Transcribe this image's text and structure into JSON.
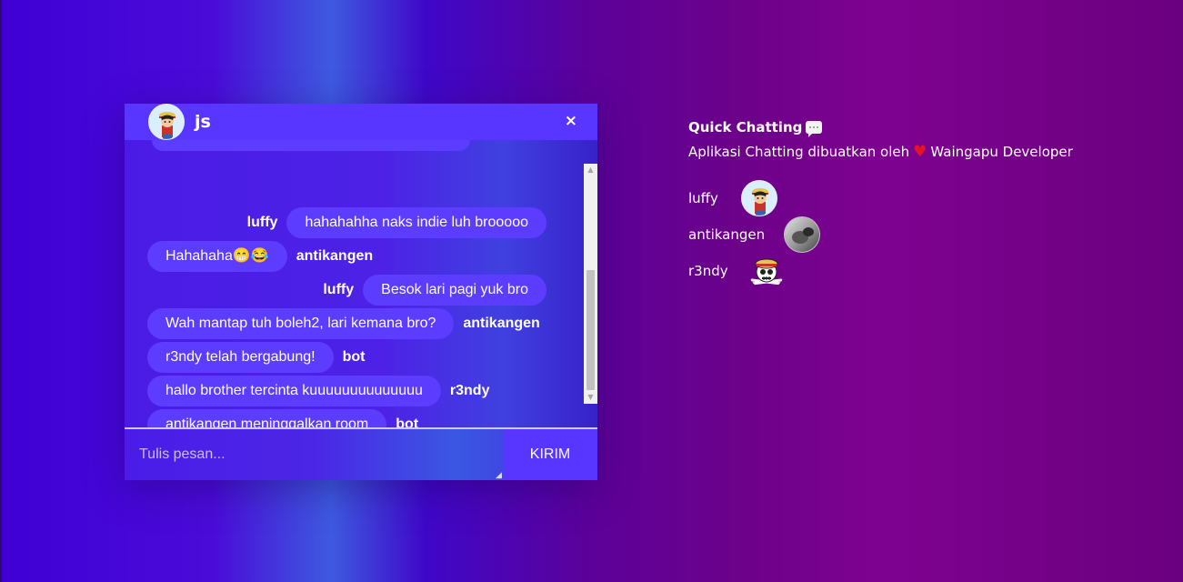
{
  "chat": {
    "title": "js",
    "close_label": "×",
    "messages": [
      {
        "sender": "luffy",
        "text": "hahahahha naks indie luh brooooo",
        "side": "right"
      },
      {
        "sender": "antikangen",
        "text": "Hahahaha😁😂",
        "side": "left"
      },
      {
        "sender": "luffy",
        "text": "Besok lari pagi yuk bro",
        "side": "right"
      },
      {
        "sender": "antikangen",
        "text": "Wah mantap tuh boleh2, lari kemana bro?",
        "side": "left"
      },
      {
        "sender": "bot",
        "text": "r3ndy telah bergabung!",
        "side": "left"
      },
      {
        "sender": "r3ndy",
        "text": "hallo brother tercinta kuuuuuuuuuuuuuu",
        "side": "left"
      },
      {
        "sender": "bot",
        "text": "antikangen meninggalkan room",
        "side": "left"
      }
    ],
    "input_placeholder": "Tulis pesan...",
    "send_label": "KIRIM"
  },
  "info": {
    "title": "Quick Chatting",
    "desc_before": "Aplikasi Chatting dibuatkan oleh",
    "heart": "♥",
    "desc_after": "Waingapu Developer"
  },
  "users": [
    {
      "name": "luffy",
      "avatar": "luffy-avatar"
    },
    {
      "name": "antikangen",
      "avatar": "photo-avatar"
    },
    {
      "name": "r3ndy",
      "avatar": "skull-avatar"
    }
  ],
  "colors": {
    "accent": "#5936ff",
    "bubble": "#5c3cff",
    "heart": "#e0142a"
  }
}
